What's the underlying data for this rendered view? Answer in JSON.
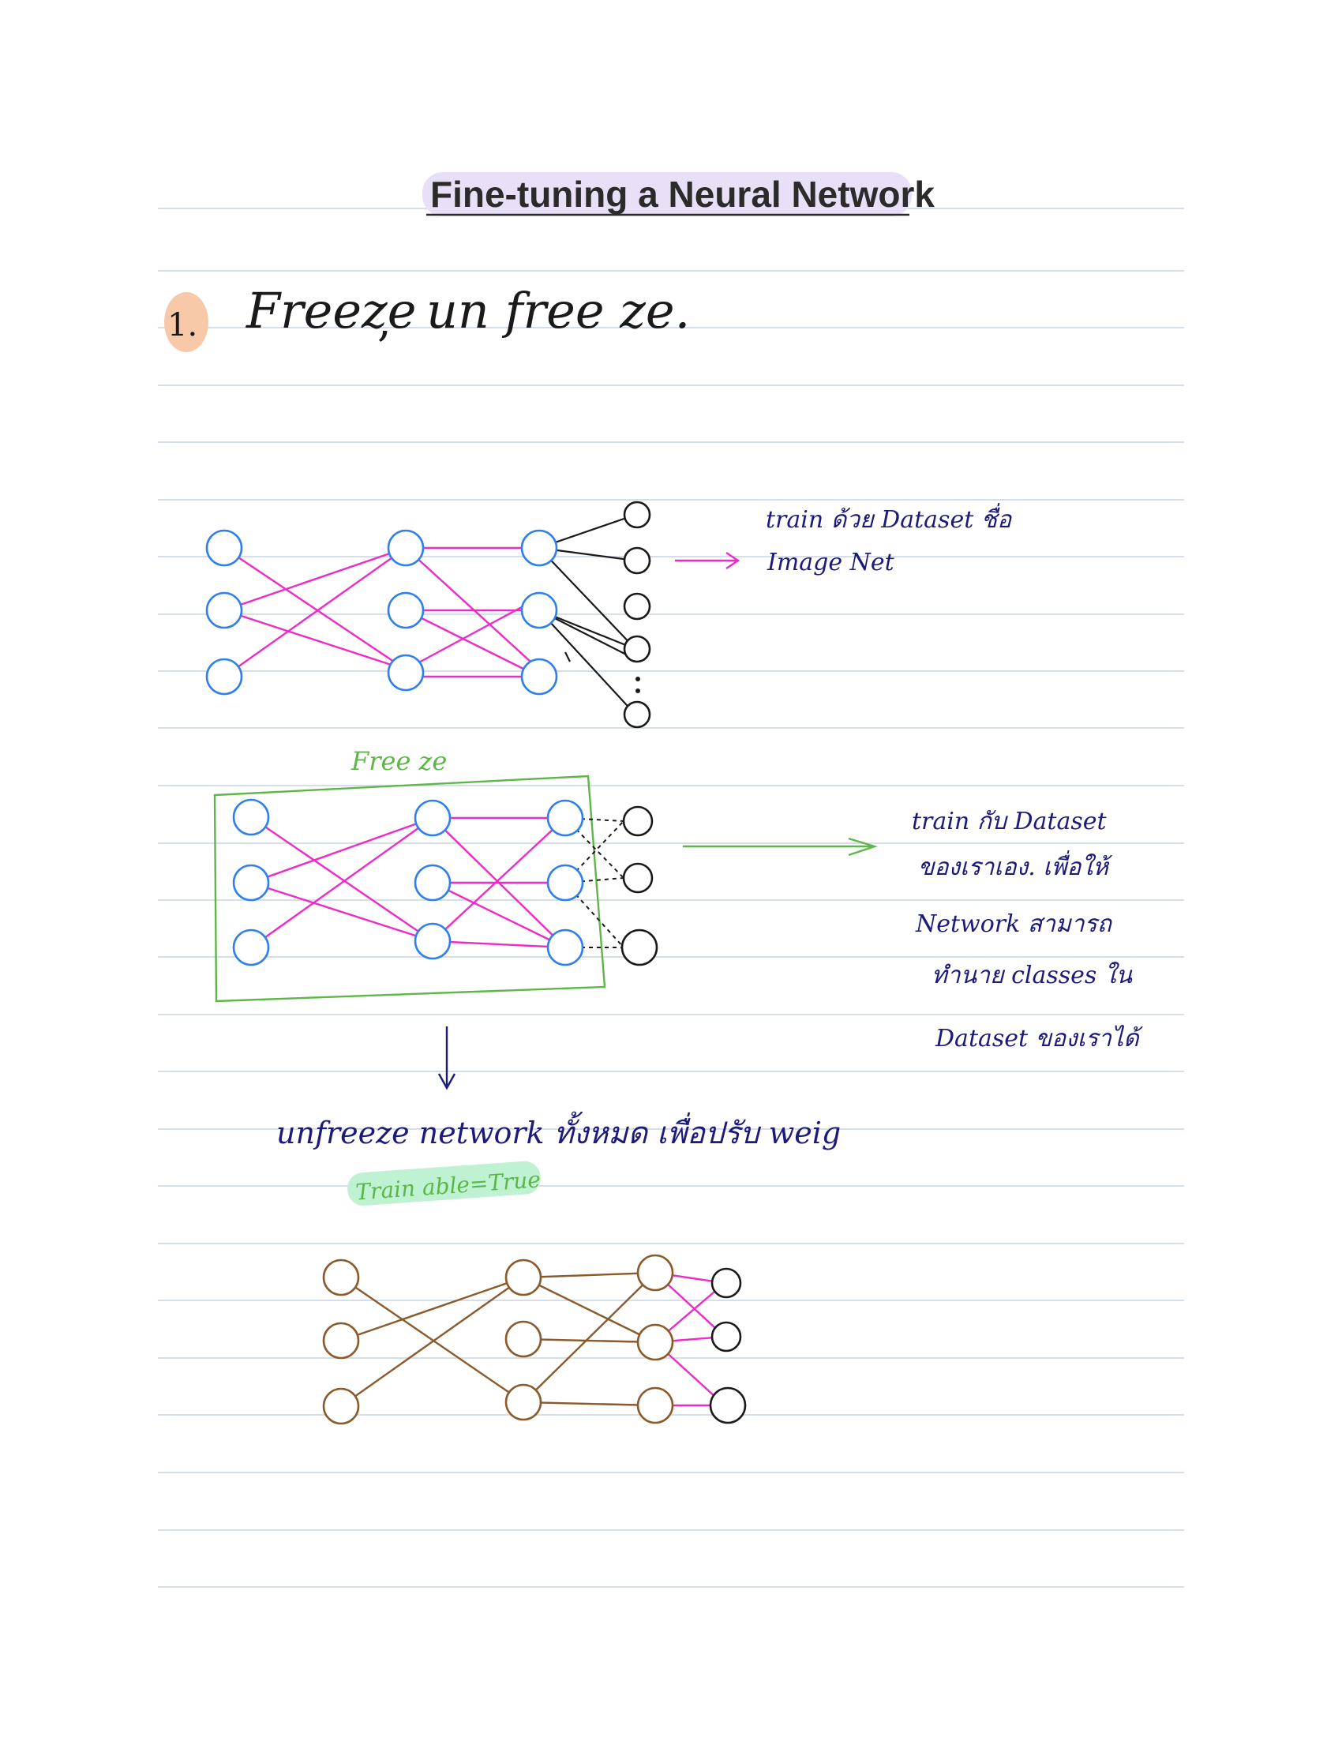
{
  "title": "Fine-tuning a Neural Network",
  "heading": {
    "number": "1.",
    "text_left": "Freeze",
    "separator": ",",
    "text_right": "un free ze."
  },
  "section1": {
    "note_line1": "train ด้วย Dataset ชื่อ",
    "note_line2": "Image Net"
  },
  "section2": {
    "label": "Free ze",
    "note_lines": [
      "train กับ Dataset",
      "ของเราเอง. เพื่อให้",
      "Network สามารถ",
      "ทำนาย classes ใน",
      "Dataset ของเราได้"
    ]
  },
  "section3": {
    "instruction": "unfreeze network ทั้งหมด เพื่อปรับ weig",
    "highlight": "Train able=True"
  },
  "colors": {
    "title_highlight": "#e8e0f7",
    "number_highlight": "#f7c9a8",
    "trainable_highlight": "#bff1d3",
    "blue_node": "#2f80ed",
    "magenta_edge": "#ee2bc8",
    "green_box": "#5fb648",
    "brown_net": "#8b5a2b",
    "navy_ink": "#1c1a7a",
    "black_ink": "#1a1a1a",
    "rule_lines": "#c9d3e3"
  }
}
